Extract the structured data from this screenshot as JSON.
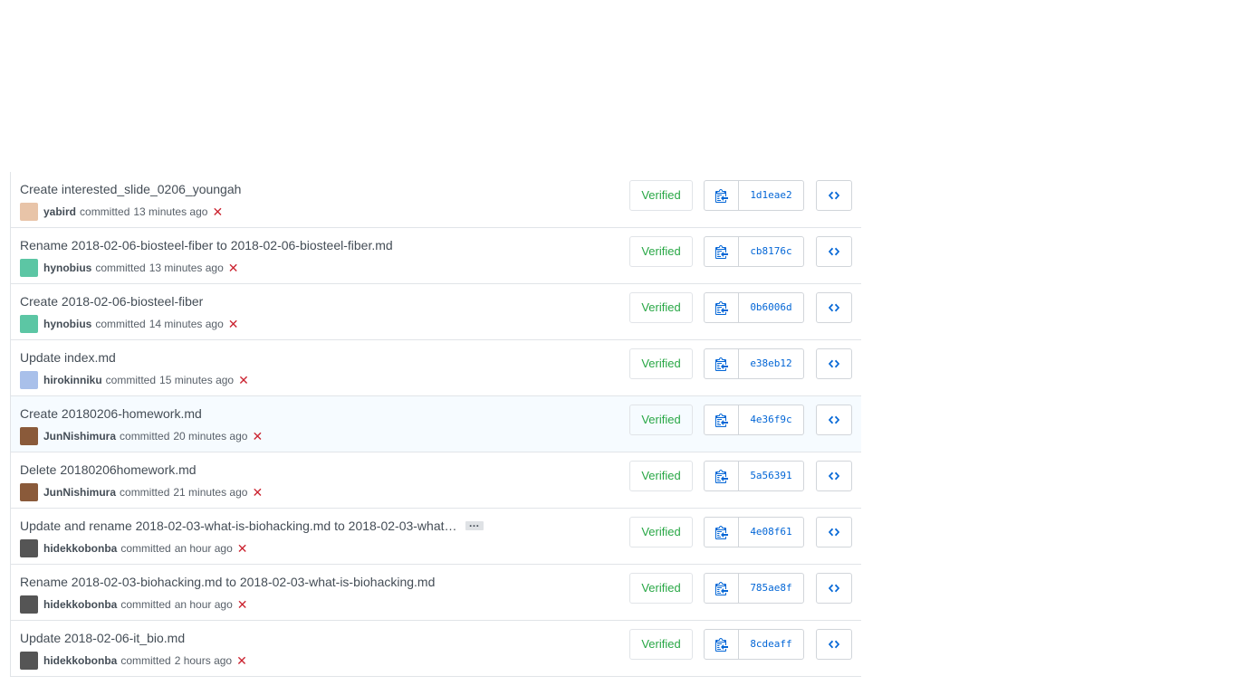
{
  "commits": [
    {
      "title": "Create interested_slide_0206_youngah",
      "author": "yabird",
      "committed": "committed",
      "time": "13 minutes ago",
      "status": "✕",
      "verified": "Verified",
      "sha": "1d1eae2",
      "avatar_color": "#e8c4a8",
      "truncated": false
    },
    {
      "title": "Rename 2018-02-06-biosteel-fiber to 2018-02-06-biosteel-fiber.md",
      "author": "hynobius",
      "committed": "committed",
      "time": "13 minutes ago",
      "status": "✕",
      "verified": "Verified",
      "sha": "cb8176c",
      "avatar_color": "#5cc6a4",
      "truncated": false
    },
    {
      "title": "Create 2018-02-06-biosteel-fiber",
      "author": "hynobius",
      "committed": "committed",
      "time": "14 minutes ago",
      "status": "✕",
      "verified": "Verified",
      "sha": "0b6006d",
      "avatar_color": "#5cc6a4",
      "truncated": false
    },
    {
      "title": "Update index.md",
      "author": "hirokinniku",
      "committed": "committed",
      "time": "15 minutes ago",
      "status": "✕",
      "verified": "Verified",
      "sha": "e38eb12",
      "avatar_color": "#a9c0ea",
      "truncated": false
    },
    {
      "title": "Create 20180206-homework.md",
      "author": "JunNishimura",
      "committed": "committed",
      "time": "20 minutes ago",
      "status": "✕",
      "verified": "Verified",
      "sha": "4e36f9c",
      "avatar_color": "#8a5a3a",
      "truncated": false
    },
    {
      "title": "Delete 20180206homework.md",
      "author": "JunNishimura",
      "committed": "committed",
      "time": "21 minutes ago",
      "status": "✕",
      "verified": "Verified",
      "sha": "5a56391",
      "avatar_color": "#8a5a3a",
      "truncated": false
    },
    {
      "title": "Update and rename 2018-02-03-what-is-biohacking.md to 2018-02-03-what…",
      "author": "hidekkobonba",
      "committed": "committed",
      "time": "an hour ago",
      "status": "✕",
      "verified": "Verified",
      "sha": "4e08f61",
      "avatar_color": "#555555",
      "truncated": true,
      "ellipsis": "…"
    },
    {
      "title": "Rename 2018-02-03-biohacking.md to 2018-02-03-what-is-biohacking.md",
      "author": "hidekkobonba",
      "committed": "committed",
      "time": "an hour ago",
      "status": "✕",
      "verified": "Verified",
      "sha": "785ae8f",
      "avatar_color": "#555555",
      "truncated": false
    },
    {
      "title": "Update 2018-02-06-it_bio.md",
      "author": "hidekkobonba",
      "committed": "committed",
      "time": "2 hours ago",
      "status": "✕",
      "verified": "Verified",
      "sha": "8cdeaff",
      "avatar_color": "#555555",
      "truncated": false
    }
  ],
  "hover_row": 4,
  "colors": {
    "link": "#0366d6",
    "verified": "#28a745",
    "fail": "#cb2431"
  },
  "icons": {
    "copy": "clippy-icon",
    "browse": "code-icon"
  }
}
